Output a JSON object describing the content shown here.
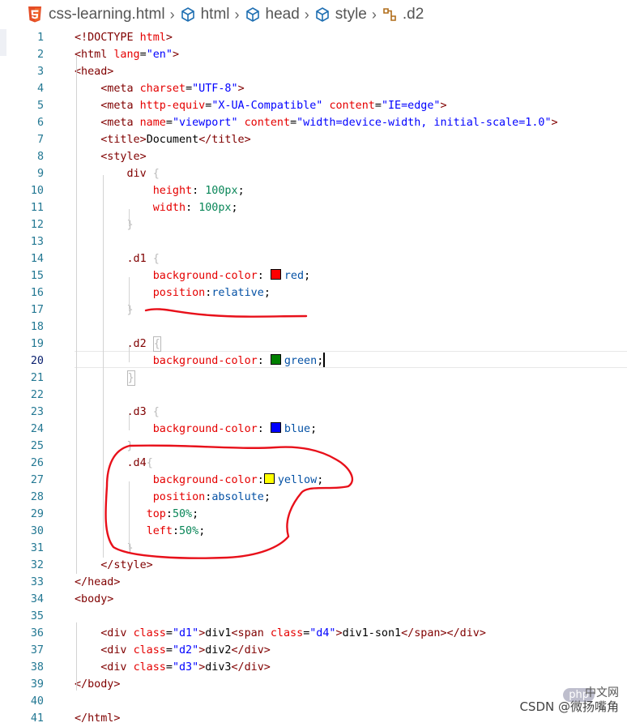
{
  "breadcrumb": {
    "file": "css-learning.html",
    "items": [
      "html",
      "head",
      "style"
    ],
    "last": ".d2"
  },
  "editor": {
    "active_line": 20,
    "lines": [
      {
        "n": "1",
        "tokens": [
          [
            "t-tag",
            "<!DOCTYPE"
          ],
          [
            "t-txt",
            " "
          ],
          [
            "t-attr",
            "html"
          ],
          [
            "t-tag",
            ">"
          ]
        ]
      },
      {
        "n": "2",
        "tokens": [
          [
            "t-tag",
            "<html"
          ],
          [
            "t-txt",
            " "
          ],
          [
            "t-attr",
            "lang"
          ],
          [
            "t-txt",
            "="
          ],
          [
            "t-str",
            "\"en\""
          ],
          [
            "t-tag",
            ">"
          ]
        ]
      },
      {
        "n": "3",
        "tokens": [
          [
            "t-tag",
            "<head>"
          ]
        ]
      },
      {
        "n": "4",
        "tokens": [
          [
            "t-txt",
            "    "
          ],
          [
            "t-tag",
            "<meta"
          ],
          [
            "t-txt",
            " "
          ],
          [
            "t-attr",
            "charset"
          ],
          [
            "t-txt",
            "="
          ],
          [
            "t-str",
            "\"UTF-8\""
          ],
          [
            "t-tag",
            ">"
          ]
        ]
      },
      {
        "n": "5",
        "tokens": [
          [
            "t-txt",
            "    "
          ],
          [
            "t-tag",
            "<meta"
          ],
          [
            "t-txt",
            " "
          ],
          [
            "t-attr",
            "http-equiv"
          ],
          [
            "t-txt",
            "="
          ],
          [
            "t-str",
            "\"X-UA-Compatible\""
          ],
          [
            "t-txt",
            " "
          ],
          [
            "t-attr",
            "content"
          ],
          [
            "t-txt",
            "="
          ],
          [
            "t-str",
            "\"IE=edge\""
          ],
          [
            "t-tag",
            ">"
          ]
        ]
      },
      {
        "n": "6",
        "tokens": [
          [
            "t-txt",
            "    "
          ],
          [
            "t-tag",
            "<meta"
          ],
          [
            "t-txt",
            " "
          ],
          [
            "t-attr",
            "name"
          ],
          [
            "t-txt",
            "="
          ],
          [
            "t-str",
            "\"viewport\""
          ],
          [
            "t-txt",
            " "
          ],
          [
            "t-attr",
            "content"
          ],
          [
            "t-txt",
            "="
          ],
          [
            "t-str",
            "\"width=device-width, initial-scale=1.0\""
          ],
          [
            "t-tag",
            ">"
          ]
        ]
      },
      {
        "n": "7",
        "tokens": [
          [
            "t-txt",
            "    "
          ],
          [
            "t-tag",
            "<title>"
          ],
          [
            "t-txt",
            "Document"
          ],
          [
            "t-tag",
            "</title>"
          ]
        ]
      },
      {
        "n": "8",
        "tokens": [
          [
            "t-txt",
            "    "
          ],
          [
            "t-tag",
            "<style>"
          ]
        ]
      },
      {
        "n": "9",
        "tokens": [
          [
            "t-txt",
            "        "
          ],
          [
            "t-sel",
            "div"
          ],
          [
            "t-txt",
            " "
          ],
          [
            "t-brace",
            "{"
          ]
        ]
      },
      {
        "n": "10",
        "tokens": [
          [
            "t-txt",
            "            "
          ],
          [
            "t-prop",
            "height"
          ],
          [
            "t-txt",
            ": "
          ],
          [
            "t-num",
            "100px"
          ],
          [
            "t-txt",
            ";"
          ]
        ]
      },
      {
        "n": "11",
        "tokens": [
          [
            "t-txt",
            "            "
          ],
          [
            "t-prop",
            "width"
          ],
          [
            "t-txt",
            ": "
          ],
          [
            "t-num",
            "100px"
          ],
          [
            "t-txt",
            ";"
          ]
        ]
      },
      {
        "n": "12",
        "tokens": [
          [
            "t-txt",
            "        "
          ],
          [
            "t-brace",
            "}"
          ]
        ]
      },
      {
        "n": "13",
        "tokens": []
      },
      {
        "n": "14",
        "tokens": [
          [
            "t-txt",
            "        "
          ],
          [
            "t-sel",
            ".d1"
          ],
          [
            "t-txt",
            " "
          ],
          [
            "t-brace",
            "{"
          ]
        ]
      },
      {
        "n": "15",
        "tokens": [
          [
            "t-txt",
            "            "
          ],
          [
            "t-prop",
            "background-color"
          ],
          [
            "t-txt",
            ": "
          ],
          [
            "swatch",
            "#ff0000"
          ],
          [
            "t-val",
            "red"
          ],
          [
            "t-txt",
            ";"
          ]
        ]
      },
      {
        "n": "16",
        "tokens": [
          [
            "t-txt",
            "            "
          ],
          [
            "t-prop",
            "position"
          ],
          [
            "t-txt",
            ":"
          ],
          [
            "t-val",
            "relative"
          ],
          [
            "t-txt",
            ";"
          ]
        ]
      },
      {
        "n": "17",
        "tokens": [
          [
            "t-txt",
            "        "
          ],
          [
            "t-brace",
            "}"
          ]
        ]
      },
      {
        "n": "18",
        "tokens": []
      },
      {
        "n": "19",
        "tokens": [
          [
            "t-txt",
            "        "
          ],
          [
            "t-sel",
            ".d2"
          ],
          [
            "t-txt",
            " "
          ],
          [
            "box",
            "{"
          ]
        ]
      },
      {
        "n": "20",
        "tokens": [
          [
            "t-txt",
            "            "
          ],
          [
            "t-prop",
            "background-color"
          ],
          [
            "t-txt",
            ": "
          ],
          [
            "swatch",
            "#008000"
          ],
          [
            "t-val",
            "green"
          ],
          [
            "t-txt",
            ";"
          ],
          [
            "caret",
            ""
          ]
        ]
      },
      {
        "n": "21",
        "tokens": [
          [
            "t-txt",
            "        "
          ],
          [
            "box",
            "}"
          ]
        ]
      },
      {
        "n": "22",
        "tokens": []
      },
      {
        "n": "23",
        "tokens": [
          [
            "t-txt",
            "        "
          ],
          [
            "t-sel",
            ".d3"
          ],
          [
            "t-txt",
            " "
          ],
          [
            "t-brace",
            "{"
          ]
        ]
      },
      {
        "n": "24",
        "tokens": [
          [
            "t-txt",
            "            "
          ],
          [
            "t-prop",
            "background-color"
          ],
          [
            "t-txt",
            ": "
          ],
          [
            "swatch",
            "#0000ff"
          ],
          [
            "t-val",
            "blue"
          ],
          [
            "t-txt",
            ";"
          ]
        ]
      },
      {
        "n": "25",
        "tokens": [
          [
            "t-txt",
            "        "
          ],
          [
            "t-brace",
            "}"
          ]
        ]
      },
      {
        "n": "26",
        "tokens": [
          [
            "t-txt",
            "        "
          ],
          [
            "t-sel",
            ".d4"
          ],
          [
            "t-brace",
            "{"
          ]
        ]
      },
      {
        "n": "27",
        "tokens": [
          [
            "t-txt",
            "            "
          ],
          [
            "t-prop",
            "background-color"
          ],
          [
            "t-txt",
            ":"
          ],
          [
            "swatch",
            "#ffff00"
          ],
          [
            "t-val",
            "yellow"
          ],
          [
            "t-txt",
            ";"
          ]
        ]
      },
      {
        "n": "28",
        "tokens": [
          [
            "t-txt",
            "            "
          ],
          [
            "t-prop",
            "position"
          ],
          [
            "t-txt",
            ":"
          ],
          [
            "t-val",
            "absolute"
          ],
          [
            "t-txt",
            ";"
          ]
        ]
      },
      {
        "n": "29",
        "tokens": [
          [
            "t-txt",
            "           "
          ],
          [
            "t-prop",
            "top"
          ],
          [
            "t-txt",
            ":"
          ],
          [
            "t-num",
            "50%"
          ],
          [
            "t-txt",
            ";"
          ]
        ]
      },
      {
        "n": "30",
        "tokens": [
          [
            "t-txt",
            "           "
          ],
          [
            "t-prop",
            "left"
          ],
          [
            "t-txt",
            ":"
          ],
          [
            "t-num",
            "50%"
          ],
          [
            "t-txt",
            ";"
          ]
        ]
      },
      {
        "n": "31",
        "tokens": [
          [
            "t-txt",
            "        "
          ],
          [
            "t-brace",
            "}"
          ]
        ]
      },
      {
        "n": "32",
        "tokens": [
          [
            "t-txt",
            "    "
          ],
          [
            "t-tag",
            "</style>"
          ]
        ]
      },
      {
        "n": "33",
        "tokens": [
          [
            "t-tag",
            "</head>"
          ]
        ]
      },
      {
        "n": "34",
        "tokens": [
          [
            "t-tag",
            "<body>"
          ]
        ]
      },
      {
        "n": "35",
        "tokens": []
      },
      {
        "n": "36",
        "tokens": [
          [
            "t-txt",
            "    "
          ],
          [
            "t-tag",
            "<div"
          ],
          [
            "t-txt",
            " "
          ],
          [
            "t-attr",
            "class"
          ],
          [
            "t-txt",
            "="
          ],
          [
            "t-str",
            "\"d1\""
          ],
          [
            "t-tag",
            ">"
          ],
          [
            "t-txt",
            "div1"
          ],
          [
            "t-tag",
            "<span"
          ],
          [
            "t-txt",
            " "
          ],
          [
            "t-attr",
            "class"
          ],
          [
            "t-txt",
            "="
          ],
          [
            "t-str",
            "\"d4\""
          ],
          [
            "t-tag",
            ">"
          ],
          [
            "t-txt",
            "div1-son1"
          ],
          [
            "t-tag",
            "</span></div>"
          ]
        ]
      },
      {
        "n": "37",
        "tokens": [
          [
            "t-txt",
            "    "
          ],
          [
            "t-tag",
            "<div"
          ],
          [
            "t-txt",
            " "
          ],
          [
            "t-attr",
            "class"
          ],
          [
            "t-txt",
            "="
          ],
          [
            "t-str",
            "\"d2\""
          ],
          [
            "t-tag",
            ">"
          ],
          [
            "t-txt",
            "div2"
          ],
          [
            "t-tag",
            "</div>"
          ]
        ]
      },
      {
        "n": "38",
        "tokens": [
          [
            "t-txt",
            "    "
          ],
          [
            "t-tag",
            "<div"
          ],
          [
            "t-txt",
            " "
          ],
          [
            "t-attr",
            "class"
          ],
          [
            "t-txt",
            "="
          ],
          [
            "t-str",
            "\"d3\""
          ],
          [
            "t-tag",
            ">"
          ],
          [
            "t-txt",
            "div3"
          ],
          [
            "t-tag",
            "</div>"
          ]
        ]
      },
      {
        "n": "39",
        "tokens": [
          [
            "t-tag",
            "</body>"
          ]
        ]
      },
      {
        "n": "40",
        "tokens": []
      },
      {
        "n": "41",
        "tokens": [
          [
            "t-tag",
            "</html>"
          ]
        ]
      }
    ]
  },
  "watermark": {
    "site": "php",
    "cn": "中文网",
    "credit": "CSDN @微扬嘴角"
  }
}
